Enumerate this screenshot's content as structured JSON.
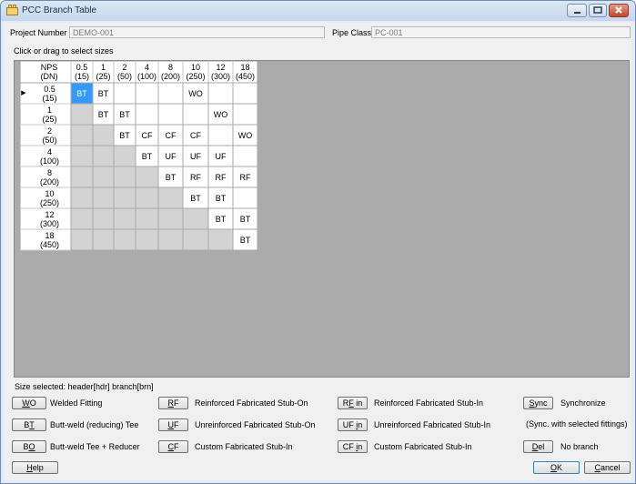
{
  "window": {
    "title": "PCC Branch Table"
  },
  "project": {
    "label": "Project Number",
    "value": "DEMO-001"
  },
  "pipe_class": {
    "label": "Pipe Class",
    "value": "PC-001"
  },
  "grid_hint": "Click or drag to select sizes",
  "table": {
    "corner": [
      "NPS",
      "(DN)"
    ],
    "columns": [
      [
        "0.5",
        "(15)"
      ],
      [
        "1",
        "(25)"
      ],
      [
        "2",
        "(50)"
      ],
      [
        "4",
        "(100)"
      ],
      [
        "8",
        "(200)"
      ],
      [
        "10",
        "(250)"
      ],
      [
        "12",
        "(300)"
      ],
      [
        "18",
        "(450)"
      ]
    ],
    "rows": [
      {
        "nps": "0.5",
        "dn": "(15)",
        "cells": [
          "BT",
          "BT",
          "",
          "",
          "",
          "WO",
          "",
          ""
        ]
      },
      {
        "nps": "1",
        "dn": "(25)",
        "cells": [
          "",
          "BT",
          "BT",
          "",
          "",
          "",
          "WO",
          ""
        ]
      },
      {
        "nps": "2",
        "dn": "(50)",
        "cells": [
          "",
          "",
          "BT",
          "CF",
          "CF",
          "CF",
          "",
          "WO"
        ]
      },
      {
        "nps": "4",
        "dn": "(100)",
        "cells": [
          "",
          "",
          "",
          "BT",
          "UF",
          "UF",
          "UF",
          ""
        ]
      },
      {
        "nps": "8",
        "dn": "(200)",
        "cells": [
          "",
          "",
          "",
          "",
          "BT",
          "RF",
          "RF",
          "RF"
        ]
      },
      {
        "nps": "10",
        "dn": "(250)",
        "cells": [
          "",
          "",
          "",
          "",
          "",
          "BT",
          "BT",
          ""
        ]
      },
      {
        "nps": "12",
        "dn": "(300)",
        "cells": [
          "",
          "",
          "",
          "",
          "",
          "",
          "BT",
          "BT"
        ]
      },
      {
        "nps": "18",
        "dn": "(450)",
        "cells": [
          "",
          "",
          "",
          "",
          "",
          "",
          "",
          "BT"
        ]
      }
    ],
    "row_marker": "▶",
    "selected": "0,0",
    "colors": {
      "header": "#ffffff",
      "lower": "#d3d3d3",
      "selected": "#3399ff",
      "background": "#ababab"
    }
  },
  "size_selected": "Size selected: header[hdr] branch[brn]",
  "legend": [
    {
      "key": "WO",
      "ul": 0,
      "desc": "Welded Fitting"
    },
    {
      "key": "BT",
      "ul": 1,
      "desc": "Butt-weld (reducing) Tee"
    },
    {
      "key": "BO",
      "ul": 1,
      "desc": "Butt-weld Tee + Reducer"
    },
    {
      "key": "RF",
      "ul": 0,
      "desc": "Reinforced Fabricated Stub-On"
    },
    {
      "key": "UF",
      "ul": 0,
      "desc": "Unreinforced Fabricated Stub-On"
    },
    {
      "key": "CF",
      "ul": 0,
      "desc": "Custom Fabricated Stub-In"
    },
    {
      "key": "RF in",
      "ul": 1,
      "desc": "Reinforced Fabricated Stub-In"
    },
    {
      "key": "UF in",
      "ul": 3,
      "desc": "Unreinforced Fabricated Stub-In"
    },
    {
      "key": "CF in",
      "ul": 3,
      "desc": "Custom Fabricated Stub-In"
    },
    {
      "key": "Sync",
      "ul": 0,
      "desc": "Synchronize"
    },
    {
      "key": "Del",
      "ul": 0,
      "desc": "No branch"
    }
  ],
  "sync_note": "(Sync. with selected fittings)",
  "footer": {
    "help": "Help",
    "ok": "OK",
    "cancel": "Cancel"
  }
}
